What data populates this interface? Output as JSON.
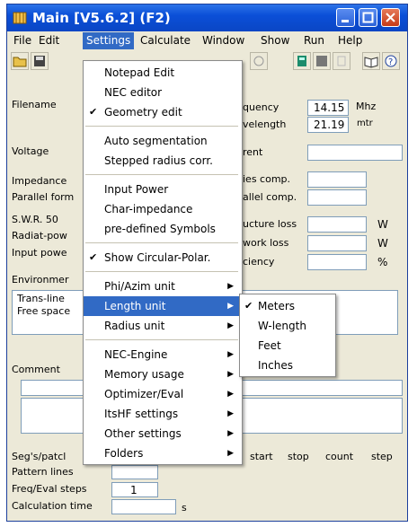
{
  "window": {
    "title": "Main [V5.6.2]  (F2)"
  },
  "menubar": [
    {
      "label": "File"
    },
    {
      "label": "Edit"
    },
    {
      "label": "Settings"
    },
    {
      "label": "Calculate"
    },
    {
      "label": "Window"
    },
    {
      "label": "Show"
    },
    {
      "label": "Run"
    },
    {
      "label": "Help"
    }
  ],
  "form": {
    "filename": "Filename",
    "frequency": "quency",
    "frequency_value": "14.15",
    "frequency_unit": "Mhz",
    "wavelength": "velength",
    "wavelength_value": "21.19",
    "wavelength_unit": "mtr",
    "voltage": "Voltage",
    "current": "rent",
    "impedance": "Impedance",
    "series_comp": "ies comp.",
    "parallel_form": "Parallel form",
    "parallel_comp": "allel comp.",
    "swr": "S.W.R. 50",
    "structure_loss": "ucture loss",
    "structure_loss_unit": "W",
    "radiat_power": "Radiat-pow",
    "network_loss": "work loss",
    "network_loss_unit": "W",
    "input_power": "Input powe",
    "efficiency": "ciency",
    "efficiency_unit": "%",
    "environment": "Environmer",
    "env_line1": "Trans-line",
    "env_line2": "Free space",
    "comment": "Comment",
    "segs_patch": "Seg's/patcl",
    "pattern_lines": "Pattern lines",
    "freq_eval_steps": "Freq/Eval steps",
    "freq_eval_steps_value": "1",
    "calculation_time": "Calculation time",
    "calculation_time_unit": "s",
    "sweep_start": "start",
    "sweep_stop": "stop",
    "sweep_count": "count",
    "sweep_step": "step"
  },
  "settings_menu": {
    "notepad_edit": "Notepad Edit",
    "nec_editor": "NEC editor",
    "geometry_edit": "Geometry edit",
    "auto_segmentation": "Auto segmentation",
    "stepped_radius": "Stepped radius corr.",
    "input_power": "Input Power",
    "char_impedance": "Char-impedance",
    "predefined_symbols": "pre-defined Symbols",
    "show_circular_polar": "Show Circular-Polar.",
    "phi_azim_unit": "Phi/Azim unit",
    "length_unit": "Length unit",
    "radius_unit": "Radius unit",
    "nec_engine": "NEC-Engine",
    "memory_usage": "Memory usage",
    "optimizer_eval": "Optimizer/Eval",
    "itshf_settings": "ItsHF settings",
    "other_settings": "Other settings",
    "folders": "Folders"
  },
  "length_unit_menu": {
    "meters": "Meters",
    "w_length": "W-length",
    "feet": "Feet",
    "inches": "Inches"
  },
  "colors": {
    "titlebar": "#0b4fd8",
    "highlight": "#316ac5",
    "window_bg": "#ece9d8"
  }
}
